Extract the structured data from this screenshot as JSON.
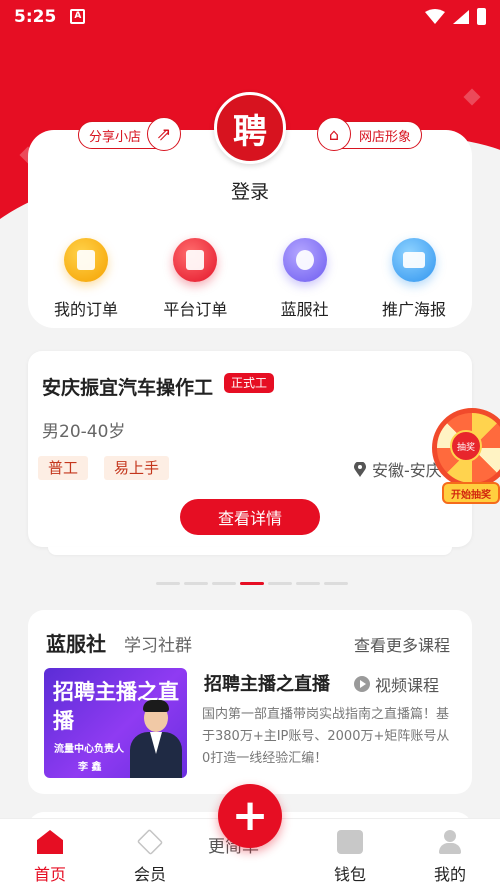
{
  "status_bar": {
    "time": "5:25",
    "sys_icon_text": "A"
  },
  "header": {
    "logo_text": "聘",
    "share_label": "分享小店",
    "store_label": "网店形象",
    "login_label": "登录"
  },
  "quick_menu": [
    {
      "label": "我的订单",
      "icon": "order-icon"
    },
    {
      "label": "平台订单",
      "icon": "clipboard-icon"
    },
    {
      "label": "蓝服社",
      "icon": "hands-icon"
    },
    {
      "label": "推广海报",
      "icon": "image-icon"
    }
  ],
  "job": {
    "title": "安庆振宜汽车操作工",
    "badge": "正式工",
    "age": "男20-40岁",
    "tags": [
      "普工",
      "易上手"
    ],
    "location": "安徽-安庆",
    "detail_button": "查看详情"
  },
  "carousel": {
    "total": 7,
    "active_index": 3
  },
  "lottery": {
    "center_text": "抽奖",
    "banner_text": "开始抽奖"
  },
  "club": {
    "title": "蓝服社",
    "subtitle": "学习社群",
    "more_label": "查看更多课程",
    "course": {
      "thumb_title": "招聘主播之直播",
      "thumb_note": "流量中心负责人",
      "thumb_name": "李 鑫",
      "name": "招聘主播之直播",
      "type": "视频课程",
      "description": "国内第一部直播带岗实战指南之直播篇！基于380万+主IP账号、2000万+矩阵账号从0打造一线经验汇编！"
    }
  },
  "next_card_text": "更简单",
  "tabbar": {
    "items": [
      {
        "label": "首页",
        "icon": "home-icon",
        "active": true
      },
      {
        "label": "会员",
        "icon": "diamond-icon",
        "active": false
      },
      {
        "label": "钱包",
        "icon": "wallet-icon",
        "active": false
      },
      {
        "label": "我的",
        "icon": "user-icon",
        "active": false
      }
    ],
    "fab_label": "+"
  },
  "colors": {
    "brand": "#e60e23",
    "tag_bg": "#fdeee4",
    "tag_text": "#c4361c"
  }
}
